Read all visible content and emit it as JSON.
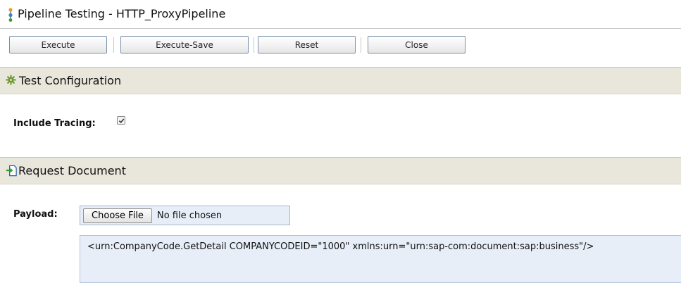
{
  "window": {
    "title": "Pipeline Testing - HTTP_ProxyPipeline",
    "title_icon": "pipeline-icon"
  },
  "toolbar": {
    "execute_label": "Execute",
    "execute_save_label": "Execute-Save",
    "reset_label": "Reset",
    "close_label": "Close"
  },
  "test_configuration": {
    "title": "Test Configuration",
    "icon": "gear-icon",
    "include_tracing_label": "Include Tracing:",
    "include_tracing_checked": true
  },
  "request_document": {
    "title": "Request Document",
    "icon": "document-import-icon",
    "payload_label": "Payload:",
    "choose_file_label": "Choose File",
    "file_status": "No file chosen",
    "payload_text": "<urn:CompanyCode.GetDetail COMPANYCODEID=\"1000\" xmlns:urn=\"urn:sap-com:document:sap:business\"/>"
  },
  "colors": {
    "section_header_bg": "#e9e6dc",
    "input_bg": "#e8eef8",
    "icon_green": "#2e9b2e",
    "icon_blue": "#2a5db0"
  }
}
